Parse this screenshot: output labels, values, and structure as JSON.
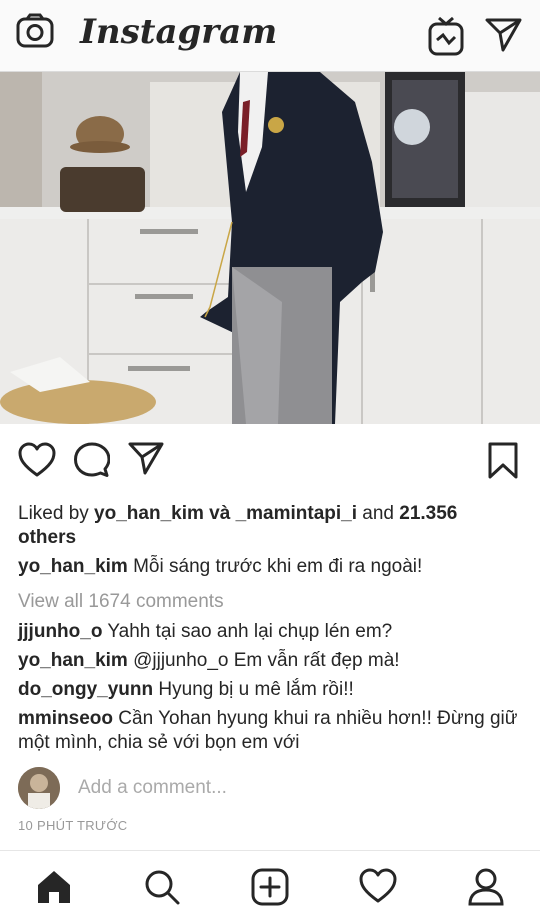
{
  "header": {
    "title": "Instagram",
    "icons": [
      "camera-icon",
      "igtv-icon",
      "direct-message-icon"
    ]
  },
  "post": {
    "liked_by": {
      "prefix": "Liked by ",
      "users": "yo_han_kim và _mamintapi_i",
      "middle": " and ",
      "count": "21.356",
      "suffix": "others"
    },
    "caption": {
      "username": "yo_han_kim",
      "text": " Mỗi sáng trước khi em đi ra ngoài!"
    },
    "view_all": "View all 1674 comments",
    "comments": [
      {
        "username": "jjjunho_o",
        "text": " Yahh tại sao anh lại chụp lén em?"
      },
      {
        "username": "yo_han_kim",
        "text": " @jjjunho_o Em vẫn rất đẹp mà!"
      },
      {
        "username": "do_ongy_yunn",
        "text": " Hyung bị u mê lắm rồi!!"
      },
      {
        "username": "mminseoo",
        "text": " Cần Yohan hyung khui ra nhiều hơn!! Đừng giữ một mình, chia sẻ với bọn em với"
      }
    ],
    "add_comment_placeholder": "Add a comment...",
    "time": "10 PHÚT TRƯỚC"
  },
  "tabbar": {
    "icons": [
      "home-icon",
      "search-icon",
      "add-post-icon",
      "activity-heart-icon",
      "profile-icon"
    ]
  },
  "colors": {
    "text": "#262626",
    "muted": "#999999",
    "background": "#ffffff"
  }
}
